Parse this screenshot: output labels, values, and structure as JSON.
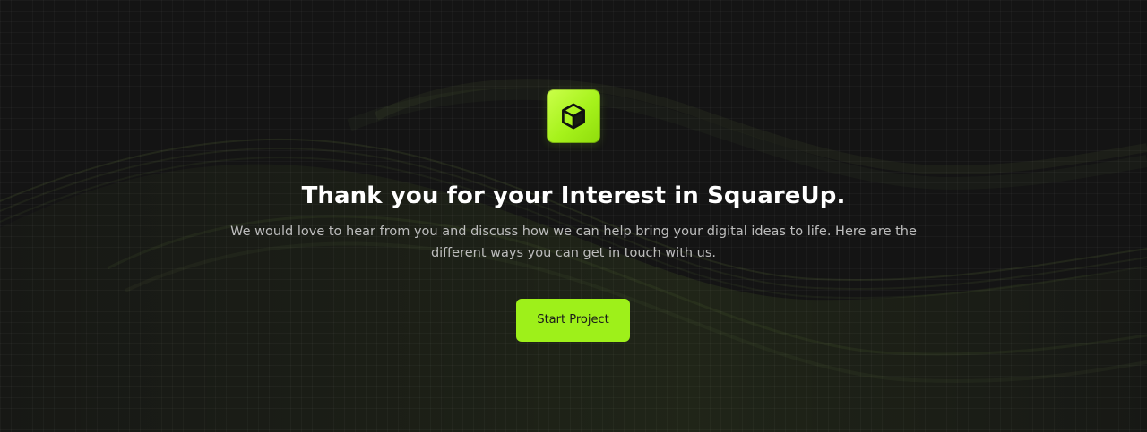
{
  "hero": {
    "logo_icon": "cube-icon",
    "title": "Thank you for your Interest in SquareUp.",
    "description": "We would love to hear from you and discuss how we can help bring your digital ideas to life. Here are the different ways you can get in touch with us.",
    "cta_label": "Start Project"
  },
  "colors": {
    "background": "#141414",
    "accent": "#9ef01a",
    "title": "#ffffff",
    "text_muted": "#bdbdbd"
  }
}
